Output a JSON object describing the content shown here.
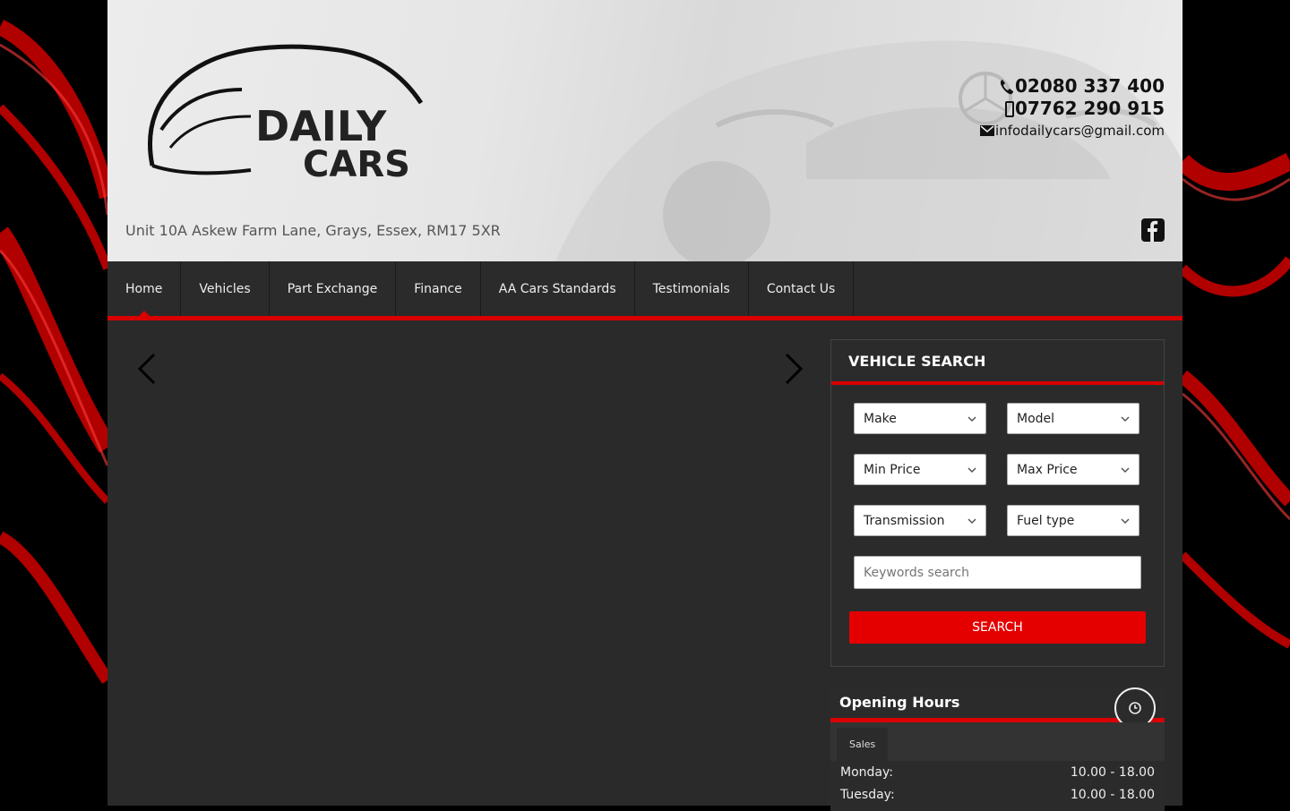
{
  "header": {
    "logo_alt": "DAILY CARS",
    "address": "Unit 10A Askew Farm Lane, Grays, Essex, RM17 5XR",
    "phone": "02080 337 400",
    "mobile": "07762 290 915",
    "email": "infodailycars@gmail.com"
  },
  "nav": {
    "items": [
      {
        "label": "Home",
        "active": true
      },
      {
        "label": "Vehicles"
      },
      {
        "label": "Part Exchange"
      },
      {
        "label": "Finance"
      },
      {
        "label": "AA Cars Standards"
      },
      {
        "label": "Testimonials"
      },
      {
        "label": "Contact Us"
      }
    ]
  },
  "vehicle_search": {
    "title": "VEHICLE SEARCH",
    "make": "Make",
    "model": "Model",
    "min_price": "Min Price",
    "max_price": "Max Price",
    "transmission": "Transmission",
    "fuel_type": "Fuel type",
    "keywords_placeholder": "Keywords search",
    "search_label": "SEARCH"
  },
  "opening_hours": {
    "title": "Opening Hours",
    "tab": "Sales",
    "rows": [
      {
        "day": "Monday:",
        "hours": "10.00 - 18.00"
      },
      {
        "day": "Tuesday:",
        "hours": "10.00 - 18.00"
      }
    ]
  },
  "colors": {
    "accent": "#d90000",
    "button": "#e50000",
    "panel": "#2b2b2b"
  }
}
